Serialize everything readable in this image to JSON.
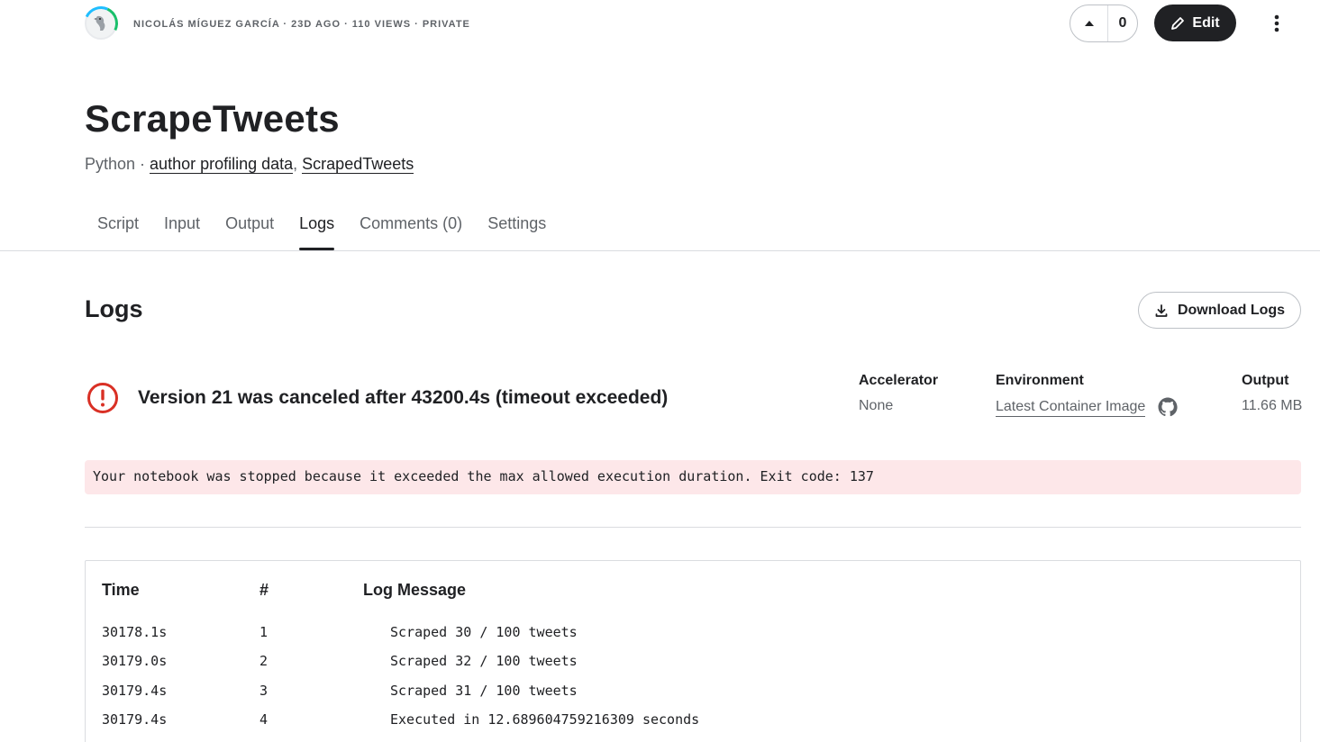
{
  "header": {
    "meta": "NICOLÁS MÍGUEZ GARCÍA · 23D AGO · 110 VIEWS · PRIVATE",
    "vote_count": "0",
    "edit_label": "Edit"
  },
  "notebook": {
    "title": "ScrapeTweets",
    "language": "Python",
    "separator": " · ",
    "datasets": [
      "author profiling data",
      "ScrapedTweets"
    ]
  },
  "tabs": [
    {
      "label": "Script",
      "active": false
    },
    {
      "label": "Input",
      "active": false
    },
    {
      "label": "Output",
      "active": false
    },
    {
      "label": "Logs",
      "active": true
    },
    {
      "label": "Comments (0)",
      "active": false
    },
    {
      "label": "Settings",
      "active": false
    }
  ],
  "logs": {
    "title": "Logs",
    "download_label": "Download Logs",
    "status": "Version 21 was canceled after 43200.4s (timeout exceeded)",
    "accelerator": {
      "label": "Accelerator",
      "value": "None"
    },
    "environment": {
      "label": "Environment",
      "value": "Latest Container Image"
    },
    "output": {
      "label": "Output",
      "value": "11.66 MB"
    },
    "banner": "Your notebook was stopped because it exceeded the max allowed execution duration. Exit code: 137",
    "columns": {
      "time": "Time",
      "num": "#",
      "message": "Log Message"
    },
    "rows": [
      {
        "time": "30178.1s",
        "num": "1",
        "message": "Scraped 30 / 100 tweets"
      },
      {
        "time": "30179.0s",
        "num": "2",
        "message": "Scraped 32 / 100 tweets"
      },
      {
        "time": "30179.4s",
        "num": "3",
        "message": "Scraped 31 / 100 tweets"
      },
      {
        "time": "30179.4s",
        "num": "4",
        "message": "Executed in 12.689604759216309 seconds"
      }
    ]
  },
  "colors": {
    "primary_dark": "#202124",
    "error_red": "#d93025",
    "banner_bg": "#fde7e9",
    "muted": "#5f6368"
  }
}
